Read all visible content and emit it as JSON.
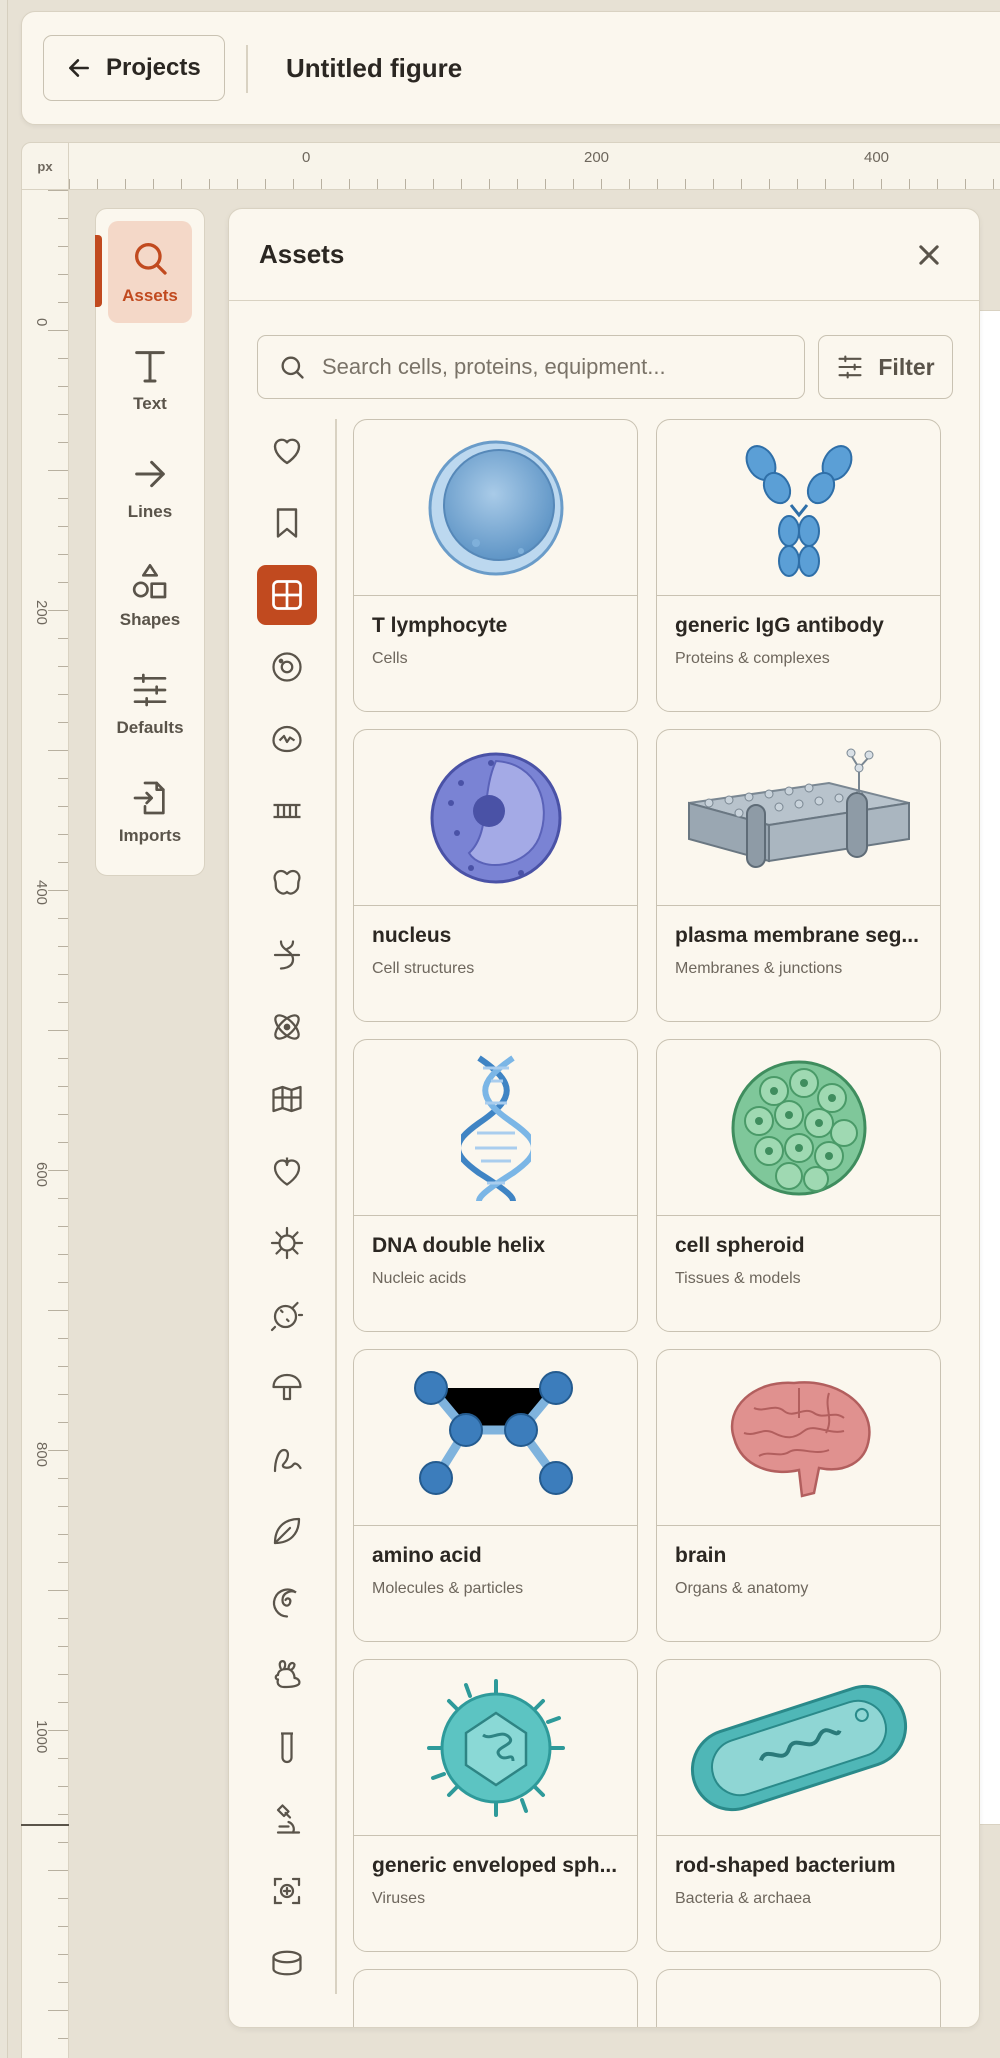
{
  "topbar": {
    "back_label": "Projects",
    "figure_title": "Untitled figure"
  },
  "ruler": {
    "unit": "px",
    "h_labels": [
      "0",
      "200",
      "400"
    ],
    "v_labels": [
      "0",
      "200",
      "400",
      "600",
      "800",
      "1000"
    ]
  },
  "toolrail": {
    "items": [
      {
        "label": "Assets",
        "icon": "search-icon",
        "active": true
      },
      {
        "label": "Text",
        "icon": "text-icon"
      },
      {
        "label": "Lines",
        "icon": "arrow-right-icon"
      },
      {
        "label": "Shapes",
        "icon": "shapes-icon"
      },
      {
        "label": "Defaults",
        "icon": "sliders-icon"
      },
      {
        "label": "Imports",
        "icon": "import-file-icon"
      }
    ]
  },
  "assets": {
    "title": "Assets",
    "search_placeholder": "Search cells, proteins, equipment...",
    "filter_label": "Filter",
    "categories": [
      "heart-icon",
      "bookmark-icon",
      "grid-icon",
      "cell-icon",
      "tissue-icon",
      "membrane-icon",
      "organ-icon",
      "dna-icon",
      "atom-icon",
      "map-icon",
      "anatomy-heart-icon",
      "virus-icon",
      "bacteria-icon",
      "mushroom-icon",
      "worm-icon",
      "leaf-icon",
      "embryo-icon",
      "rabbit-icon",
      "test-tube-icon",
      "microscope-icon",
      "focus-plus-icon",
      "petri-dish-icon"
    ],
    "items": [
      {
        "name": "T lymphocyte",
        "category": "Cells"
      },
      {
        "name": "generic IgG antibody",
        "category": "Proteins & complexes"
      },
      {
        "name": "nucleus",
        "category": "Cell structures"
      },
      {
        "name": "plasma membrane seg...",
        "category": "Membranes & junctions"
      },
      {
        "name": "DNA double helix",
        "category": "Nucleic acids"
      },
      {
        "name": "cell spheroid",
        "category": "Tissues & models"
      },
      {
        "name": "amino acid",
        "category": "Molecules & particles"
      },
      {
        "name": "brain",
        "category": "Organs & anatomy"
      },
      {
        "name": "generic enveloped sph...",
        "category": "Viruses"
      },
      {
        "name": "rod-shaped bacterium",
        "category": "Bacteria & archaea"
      }
    ]
  },
  "colors": {
    "accent": "#c14a1f",
    "accent_soft": "#f4d8c8",
    "panel": "#fbf7ee",
    "border": "#c9c2b2",
    "background": "#e7e1d4"
  }
}
